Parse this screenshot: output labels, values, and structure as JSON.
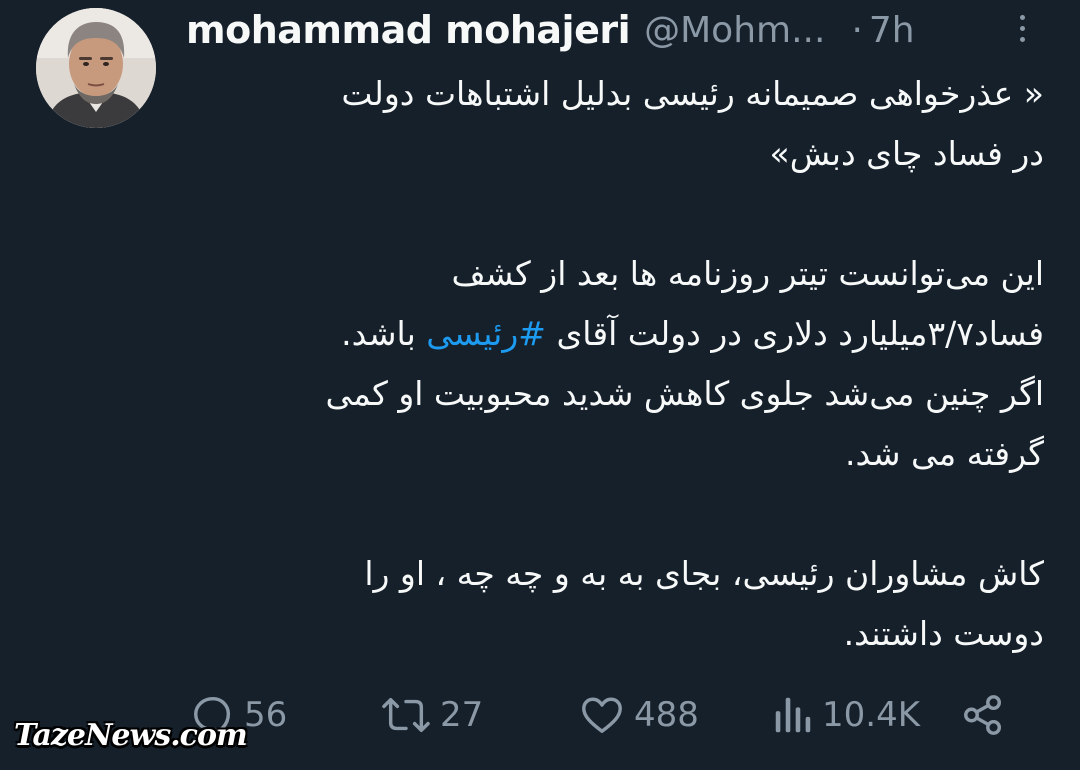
{
  "author": {
    "name": "mohammad mohajeri",
    "handle": "@Mohm...",
    "time": "7h"
  },
  "tweet": {
    "lines": [
      "« عذرخواهی صمیمانه رئیسی بدلیل اشتباهات دولت",
      "در فساد چای دبش»",
      "",
      "این می‌توانست تیتر روزنامه ها بعد از کشف",
      "فساد۳/۷میلیارد دلاری در دولت آقای ",
      "اگر چنین می‌شد جلوی کاهش شدید محبوبیت او کمی",
      "گرفته می شد.",
      "",
      "کاش مشاوران رئیسی، بجای به به و چه چه ، او را",
      "دوست داشتند."
    ],
    "hashtag": "#رئیسی",
    "after_hashtag": " باشد."
  },
  "actions": {
    "replies": "56",
    "retweets": "27",
    "likes": "488",
    "views": "10.4K"
  },
  "icons": {
    "reply": "reply-icon",
    "retweet": "retweet-icon",
    "like": "heart-icon",
    "views": "views-icon",
    "share": "share-icon",
    "more": "more-icon"
  },
  "colors": {
    "background": "#15202b",
    "text": "#f7f9f9",
    "muted": "#8b98a5",
    "hashtag": "#1d9bf0"
  },
  "watermark": "TazeNews.com"
}
